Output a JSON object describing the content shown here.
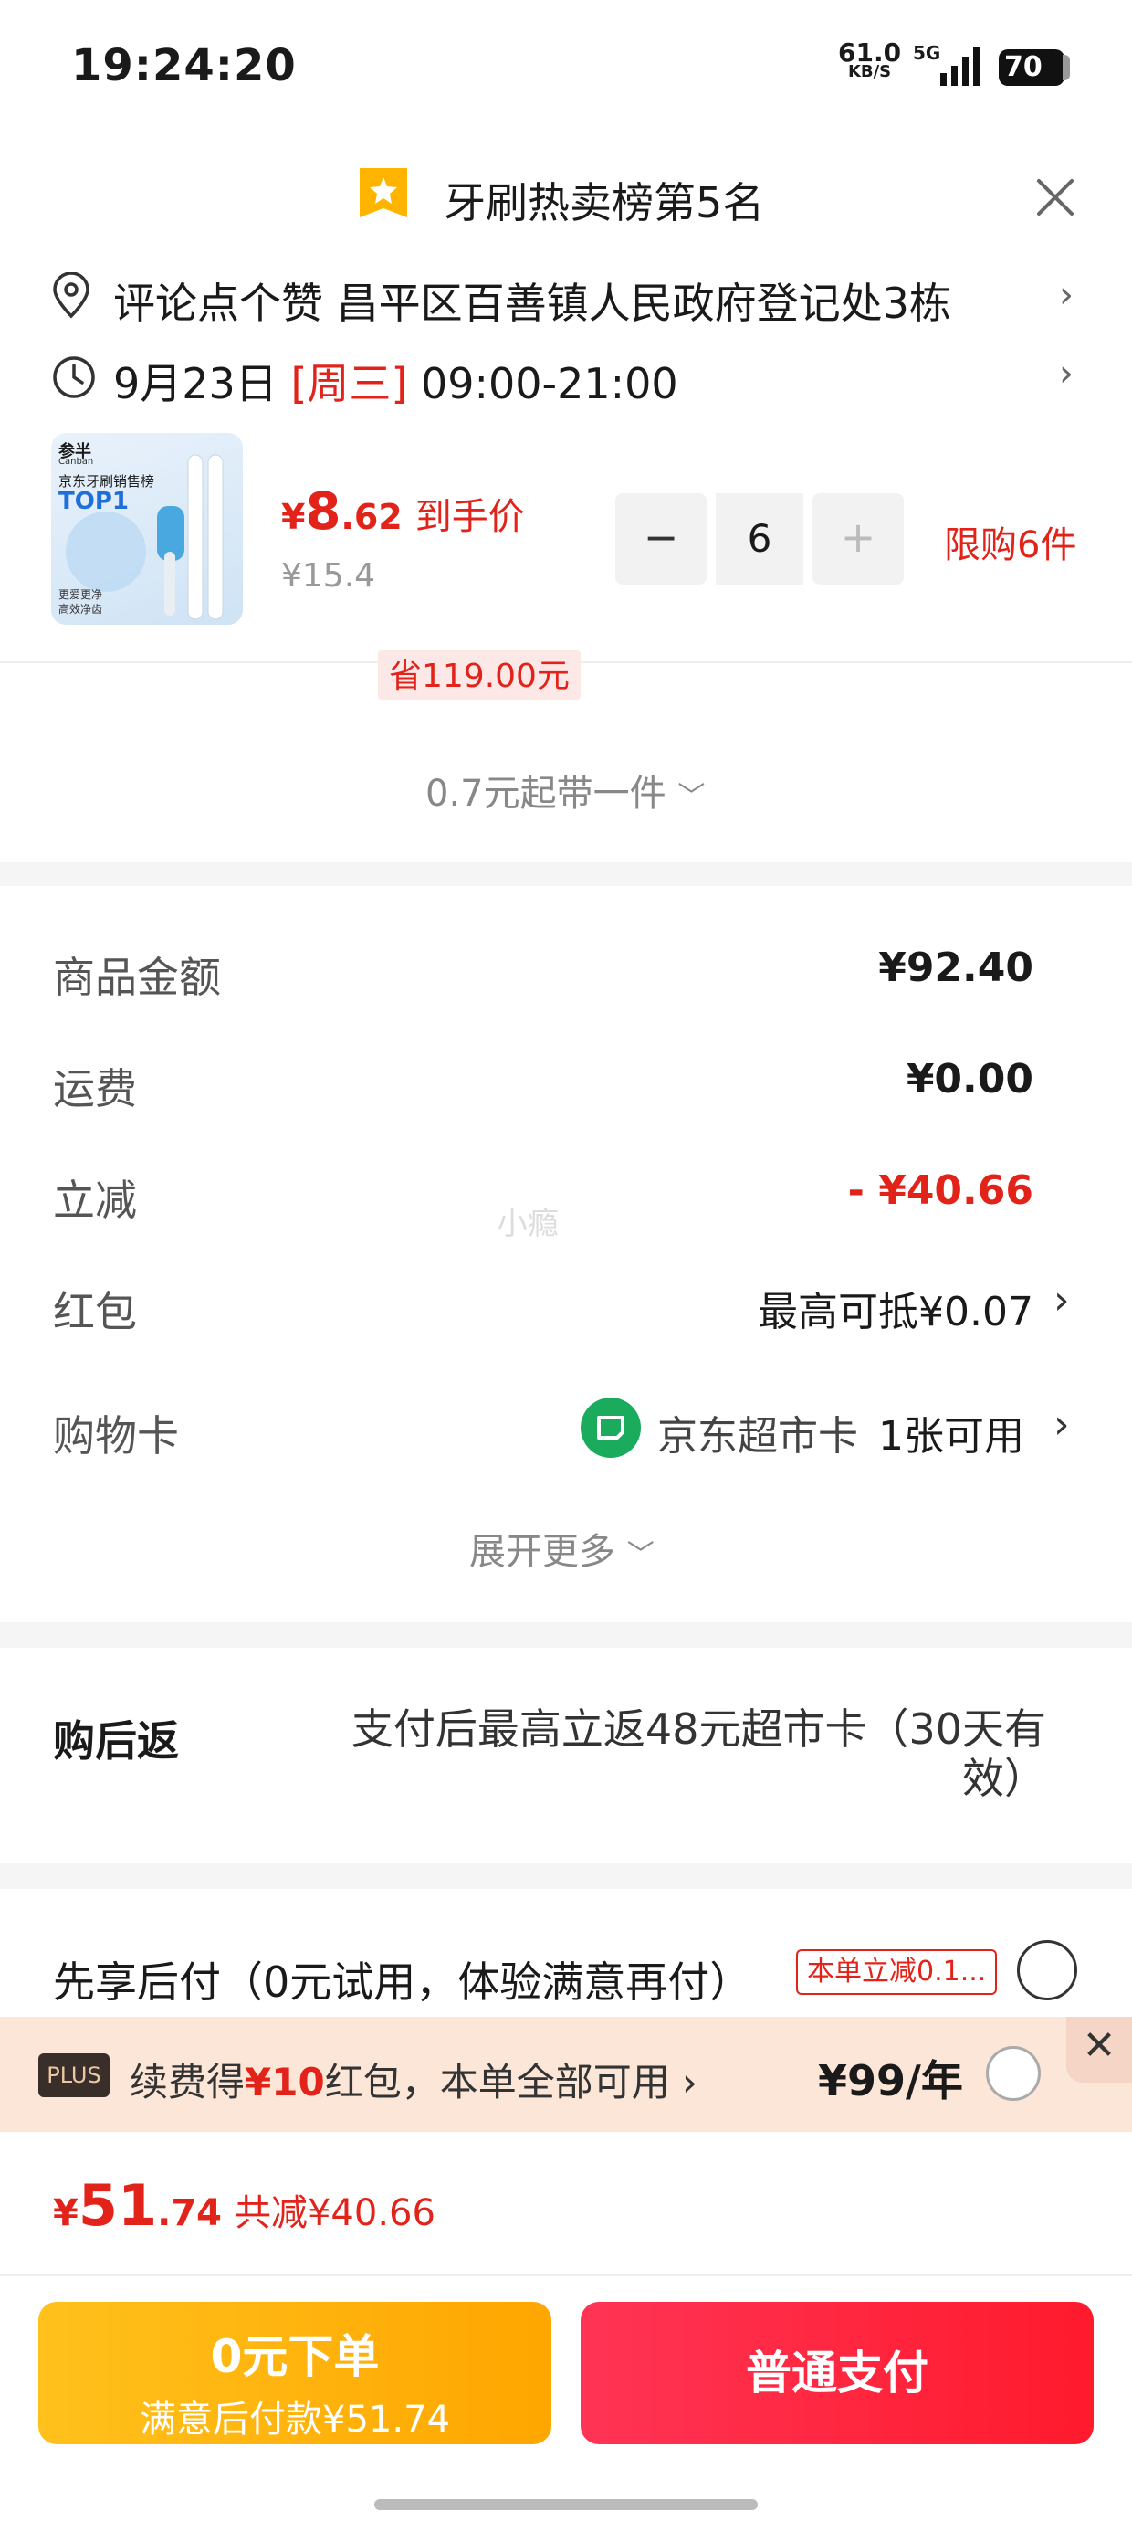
{
  "status_bar": {
    "time": "19:24:20",
    "net_speed": "61.0",
    "net_unit": "KB/S",
    "network": "5G",
    "battery": "70"
  },
  "header": {
    "rank_text": "牙刷热卖榜第5名"
  },
  "address": {
    "text": "评论点个赞  昌平区百善镇人民政府登记处3栋"
  },
  "delivery": {
    "date": "9月23日",
    "day": "[周三]",
    "time": "09:00-21:00"
  },
  "product": {
    "image_brand": "参半",
    "image_brand_en": "Canban",
    "image_rank_label": "京东牙刷销售榜",
    "image_rank": "TOP1",
    "image_caption_1": "更爱更净",
    "image_caption_2": "高效净齿",
    "price_symbol": "¥",
    "price_int": "8",
    "price_dec": ".62",
    "price_tag": "到手价",
    "original_price": "¥15.4",
    "quantity": "6",
    "minus": "−",
    "plus": "+",
    "limit": "限购6件",
    "saving_badge": "省119.00元",
    "unit_price_line": "0.7元起带一件"
  },
  "amounts": {
    "goods_label": "商品金额",
    "goods_value": "¥92.40",
    "shipping_label": "运费",
    "shipping_value": "¥0.00",
    "discount_label": "立减",
    "discount_value": "- ¥40.66",
    "redpacket_label": "红包",
    "redpacket_value": "最高可抵¥0.07",
    "giftcard_label": "购物卡",
    "giftcard_name": "京东超市卡",
    "giftcard_count": "1张可用",
    "expand_more": "展开更多",
    "watermark": "小瘾"
  },
  "cashback": {
    "label": "购后返",
    "text": "支付后最高立返48元超市卡（30天有效）"
  },
  "paylater": {
    "text": "先享后付（0元试用，体验满意再付）",
    "badge": "本单立减0.1..."
  },
  "plus_bar": {
    "badge": "PLUS",
    "text_prefix": "续费得",
    "text_highlight": "¥10",
    "text_suffix": "红包，本单全部可用",
    "price": "¥99/年",
    "close": "✕"
  },
  "footer": {
    "total_symbol": "¥",
    "total_int": "51",
    "total_dec": ".74",
    "total_saving": "共减¥40.66",
    "zero_btn_main": "0元下单",
    "zero_btn_sub": "满意后付款¥51.74",
    "pay_btn": "普通支付"
  },
  "colors": {
    "accent_red": "#e2231a",
    "pay_yellow": "#ffb400",
    "giftcard_green": "#1aac5c"
  }
}
